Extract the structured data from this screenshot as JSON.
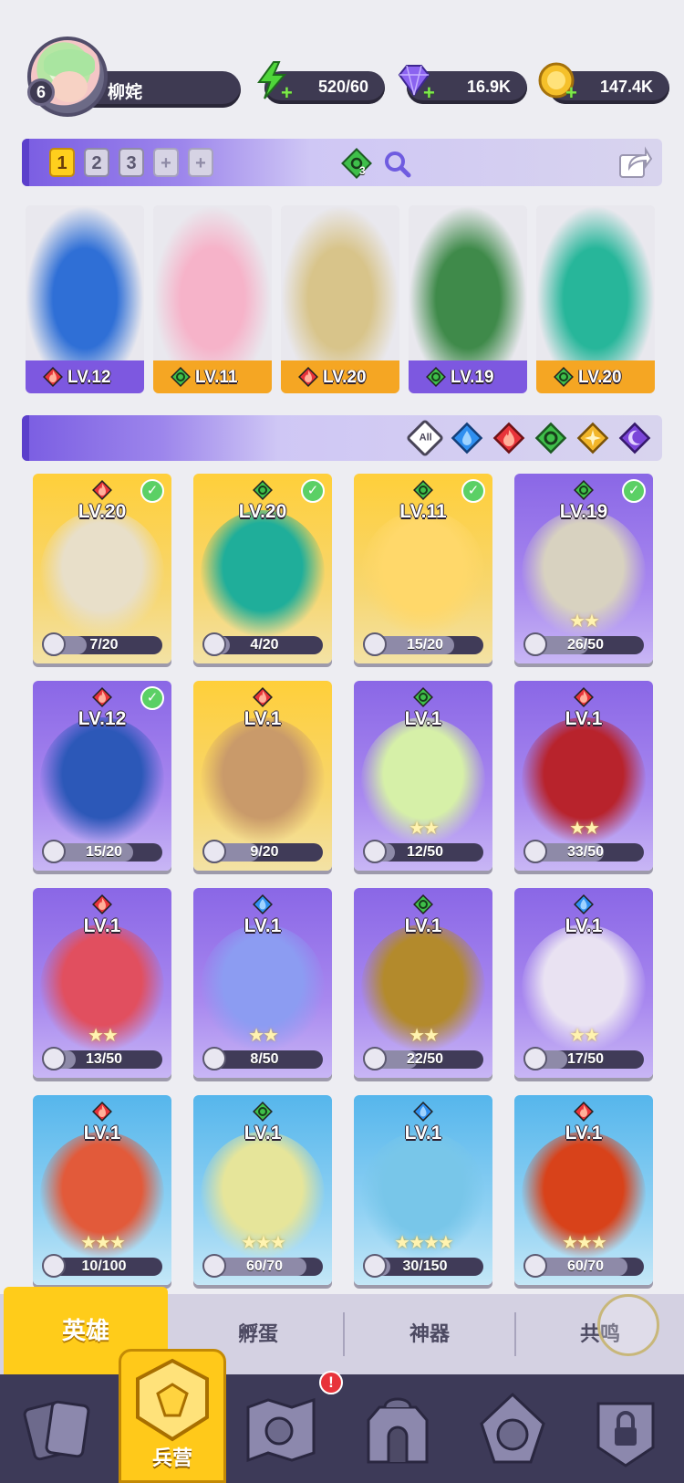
{
  "player": {
    "level": "6",
    "name": "柳姹"
  },
  "resources": [
    {
      "id": "energy",
      "value": "520/60",
      "color": "#4fd63a"
    },
    {
      "id": "gems",
      "value": "16.9K",
      "color": "#8b63f0"
    },
    {
      "id": "coins",
      "value": "147.4K",
      "color": "#f5c02a"
    }
  ],
  "team_slots": [
    "1",
    "2",
    "3",
    "+",
    "+"
  ],
  "team_element_count": "3",
  "team": [
    {
      "level": "LV.12",
      "element": "fire",
      "footer": "purple",
      "color": "#2f6fd6"
    },
    {
      "level": "LV.11",
      "element": "wind",
      "footer": "gold",
      "color": "#f6b3c9"
    },
    {
      "level": "LV.20",
      "element": "fire",
      "footer": "gold",
      "color": "#d8c48a"
    },
    {
      "level": "LV.19",
      "element": "wind",
      "footer": "purple",
      "color": "#3f8a4a"
    },
    {
      "level": "LV.20",
      "element": "wind",
      "footer": "gold",
      "color": "#27b69a"
    }
  ],
  "filters": [
    "All",
    "water",
    "fire",
    "wind",
    "light",
    "dark"
  ],
  "filter_all_label": "All",
  "heroes": [
    {
      "level": "LV.20",
      "element": "fire",
      "bg": "gold",
      "progress": "7/20",
      "ratio": 0.35,
      "selected": true,
      "stars": "",
      "color": "#e8dfc9"
    },
    {
      "level": "LV.20",
      "element": "wind",
      "bg": "gold",
      "progress": "4/20",
      "ratio": 0.2,
      "selected": true,
      "stars": "",
      "color": "#1fae9a"
    },
    {
      "level": "LV.11",
      "element": "wind",
      "bg": "gold",
      "progress": "15/20",
      "ratio": 0.75,
      "selected": true,
      "stars": "",
      "color": "#ffd86a"
    },
    {
      "level": "LV.19",
      "element": "wind",
      "bg": "purple",
      "progress": "26/50",
      "ratio": 0.52,
      "selected": true,
      "stars": "★★",
      "color": "#d8d2c0"
    },
    {
      "level": "LV.12",
      "element": "fire",
      "bg": "purple",
      "progress": "15/20",
      "ratio": 0.75,
      "selected": true,
      "stars": "",
      "color": "#2c58b8"
    },
    {
      "level": "LV.1",
      "element": "fire",
      "bg": "gold",
      "progress": "9/20",
      "ratio": 0.45,
      "selected": false,
      "stars": "",
      "color": "#c99a6a"
    },
    {
      "level": "LV.1",
      "element": "wind",
      "bg": "purple",
      "progress": "12/50",
      "ratio": 0.24,
      "selected": false,
      "stars": "★★",
      "color": "#d6f0a8"
    },
    {
      "level": "LV.1",
      "element": "fire",
      "bg": "purple",
      "progress": "33/50",
      "ratio": 0.66,
      "selected": false,
      "stars": "★★",
      "color": "#b8232c"
    },
    {
      "level": "LV.1",
      "element": "fire",
      "bg": "purple",
      "progress": "13/50",
      "ratio": 0.26,
      "selected": false,
      "stars": "★★",
      "color": "#e14f5f"
    },
    {
      "level": "LV.1",
      "element": "water",
      "bg": "purple",
      "progress": "8/50",
      "ratio": 0.16,
      "selected": false,
      "stars": "★★",
      "color": "#8c9cf2"
    },
    {
      "level": "LV.1",
      "element": "wind",
      "bg": "purple",
      "progress": "22/50",
      "ratio": 0.44,
      "selected": false,
      "stars": "★★",
      "color": "#b38a2c"
    },
    {
      "level": "LV.1",
      "element": "water",
      "bg": "purple",
      "progress": "17/50",
      "ratio": 0.34,
      "selected": false,
      "stars": "★★",
      "color": "#e9e2f2"
    },
    {
      "level": "LV.1",
      "element": "fire",
      "bg": "blue",
      "progress": "10/100",
      "ratio": 0.1,
      "selected": false,
      "stars": "★★★",
      "color": "#e25a3a"
    },
    {
      "level": "LV.1",
      "element": "wind",
      "bg": "blue",
      "progress": "60/70",
      "ratio": 0.86,
      "selected": false,
      "stars": "★★★",
      "color": "#e6e59a"
    },
    {
      "level": "LV.1",
      "element": "water",
      "bg": "blue",
      "progress": "30/150",
      "ratio": 0.2,
      "selected": false,
      "stars": "★★★★",
      "color": "#78c6e9"
    },
    {
      "level": "LV.1",
      "element": "fire",
      "bg": "blue",
      "progress": "60/70",
      "ratio": 0.86,
      "selected": false,
      "stars": "★★★",
      "color": "#d8421a"
    }
  ],
  "tabs": [
    "英雄",
    "孵蛋",
    "神器",
    "共鸣"
  ],
  "active_tab": "英雄",
  "nav": [
    {
      "id": "cards",
      "label": ""
    },
    {
      "id": "barracks",
      "label": "兵营"
    },
    {
      "id": "map",
      "label": ""
    },
    {
      "id": "castle",
      "label": ""
    },
    {
      "id": "guild",
      "label": ""
    },
    {
      "id": "locked",
      "label": ""
    }
  ],
  "nav_active_label": "兵营",
  "nav_badge": "!",
  "element_colors": {
    "fire": "#e8343a",
    "wind": "#3fbf4a",
    "water": "#2f8ff0",
    "light": "#f2b62a",
    "dark": "#7b45d9"
  }
}
